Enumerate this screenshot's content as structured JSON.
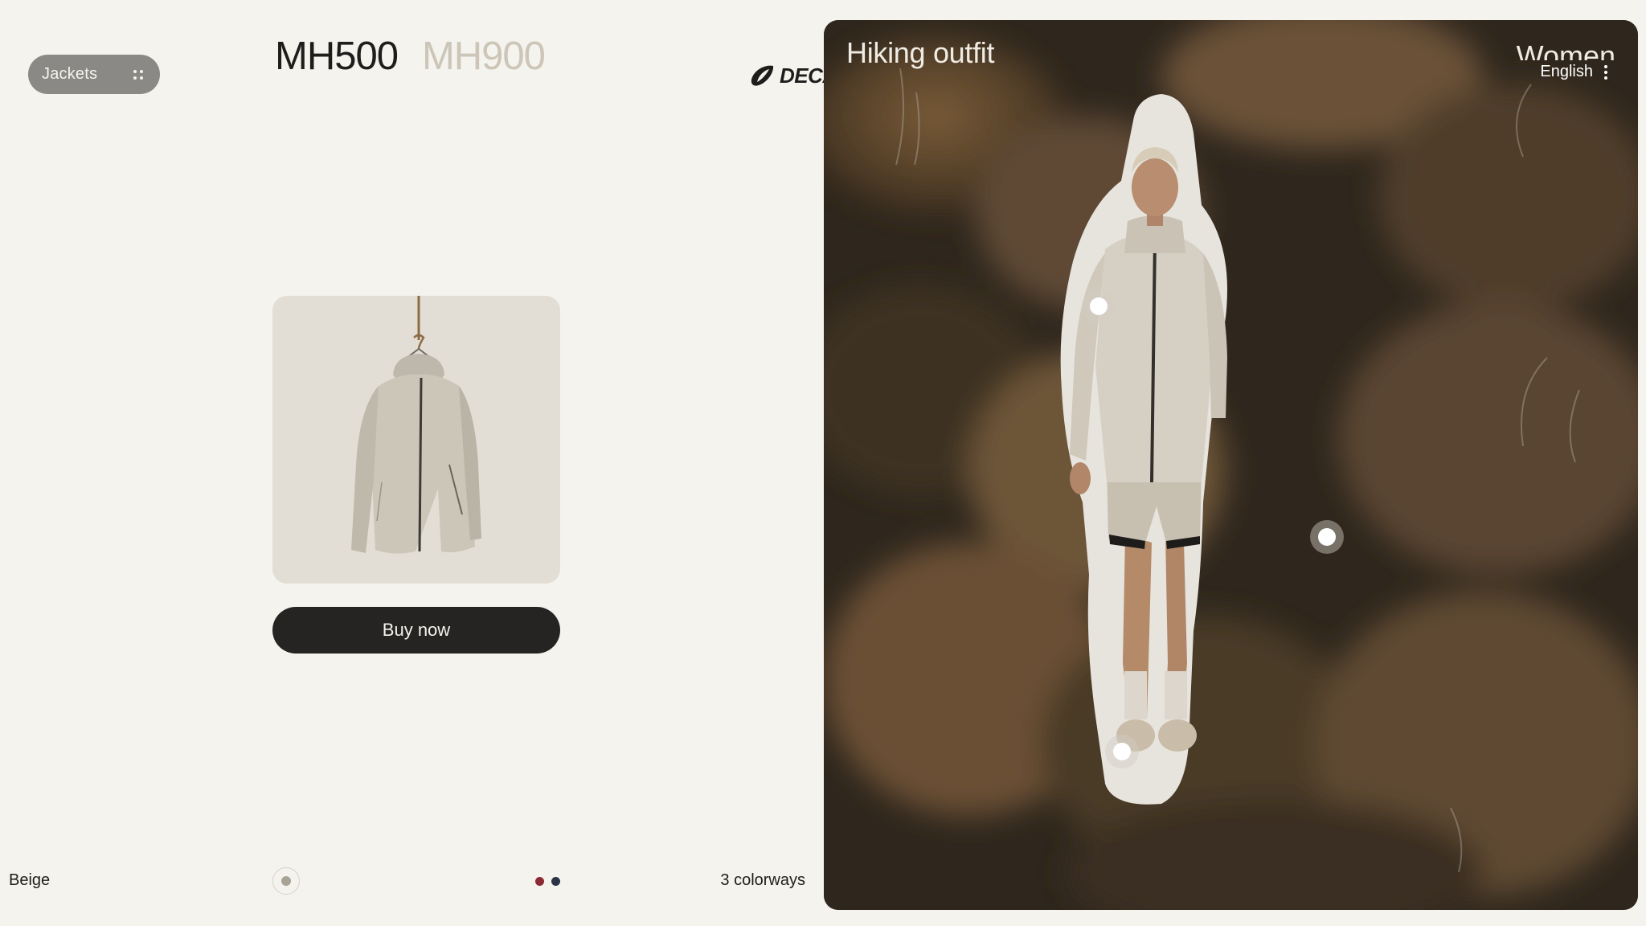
{
  "category": {
    "label": "Jackets",
    "icon": "dots-grid-icon"
  },
  "models": [
    {
      "label": "MH500",
      "active": true
    },
    {
      "label": "MH900",
      "active": false
    }
  ],
  "brand": {
    "name": "DECATHLON"
  },
  "product": {
    "image": "beige-hooded-jacket-on-hanger"
  },
  "buy_button": {
    "label": "Buy now"
  },
  "footer": {
    "color_name": "Beige",
    "selected_swatch": "#a9a396",
    "other_swatches": [
      "#8c2a33",
      "#2a3446"
    ],
    "colorways_label": "3 colorways"
  },
  "hero": {
    "title": "Hiking outfit",
    "gender": "Women",
    "language": "English",
    "hotspot_count": 3
  },
  "colors": {
    "background": "#f4f3ee",
    "dark": "#262422",
    "muted_tab": "#cdc6b8",
    "pill": "#8b8985"
  }
}
